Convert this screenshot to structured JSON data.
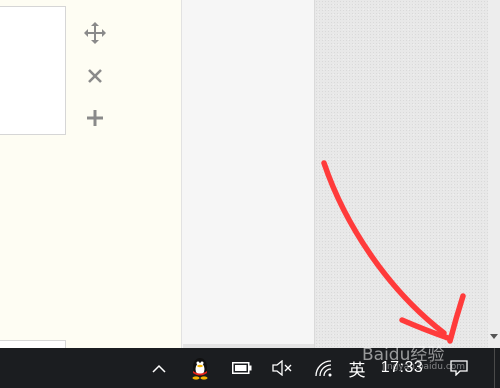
{
  "taskbar": {
    "ime_label": "英",
    "clock_text": "17:33"
  },
  "watermark": {
    "main": "Baidu经验",
    "sub": "jingyan.baidu.com"
  },
  "colors": {
    "annotation_arrow": "#ff3b3b",
    "taskbar": "#1b1d20",
    "left_panel": "#fefdf3"
  },
  "icons": [
    "move-icon",
    "close-icon",
    "add-icon",
    "chevron-up-icon",
    "qq-penguin-icon",
    "battery-icon",
    "volume-mute-icon",
    "wifi-icon",
    "notification-icon",
    "scroll-down-arrow-icon"
  ]
}
